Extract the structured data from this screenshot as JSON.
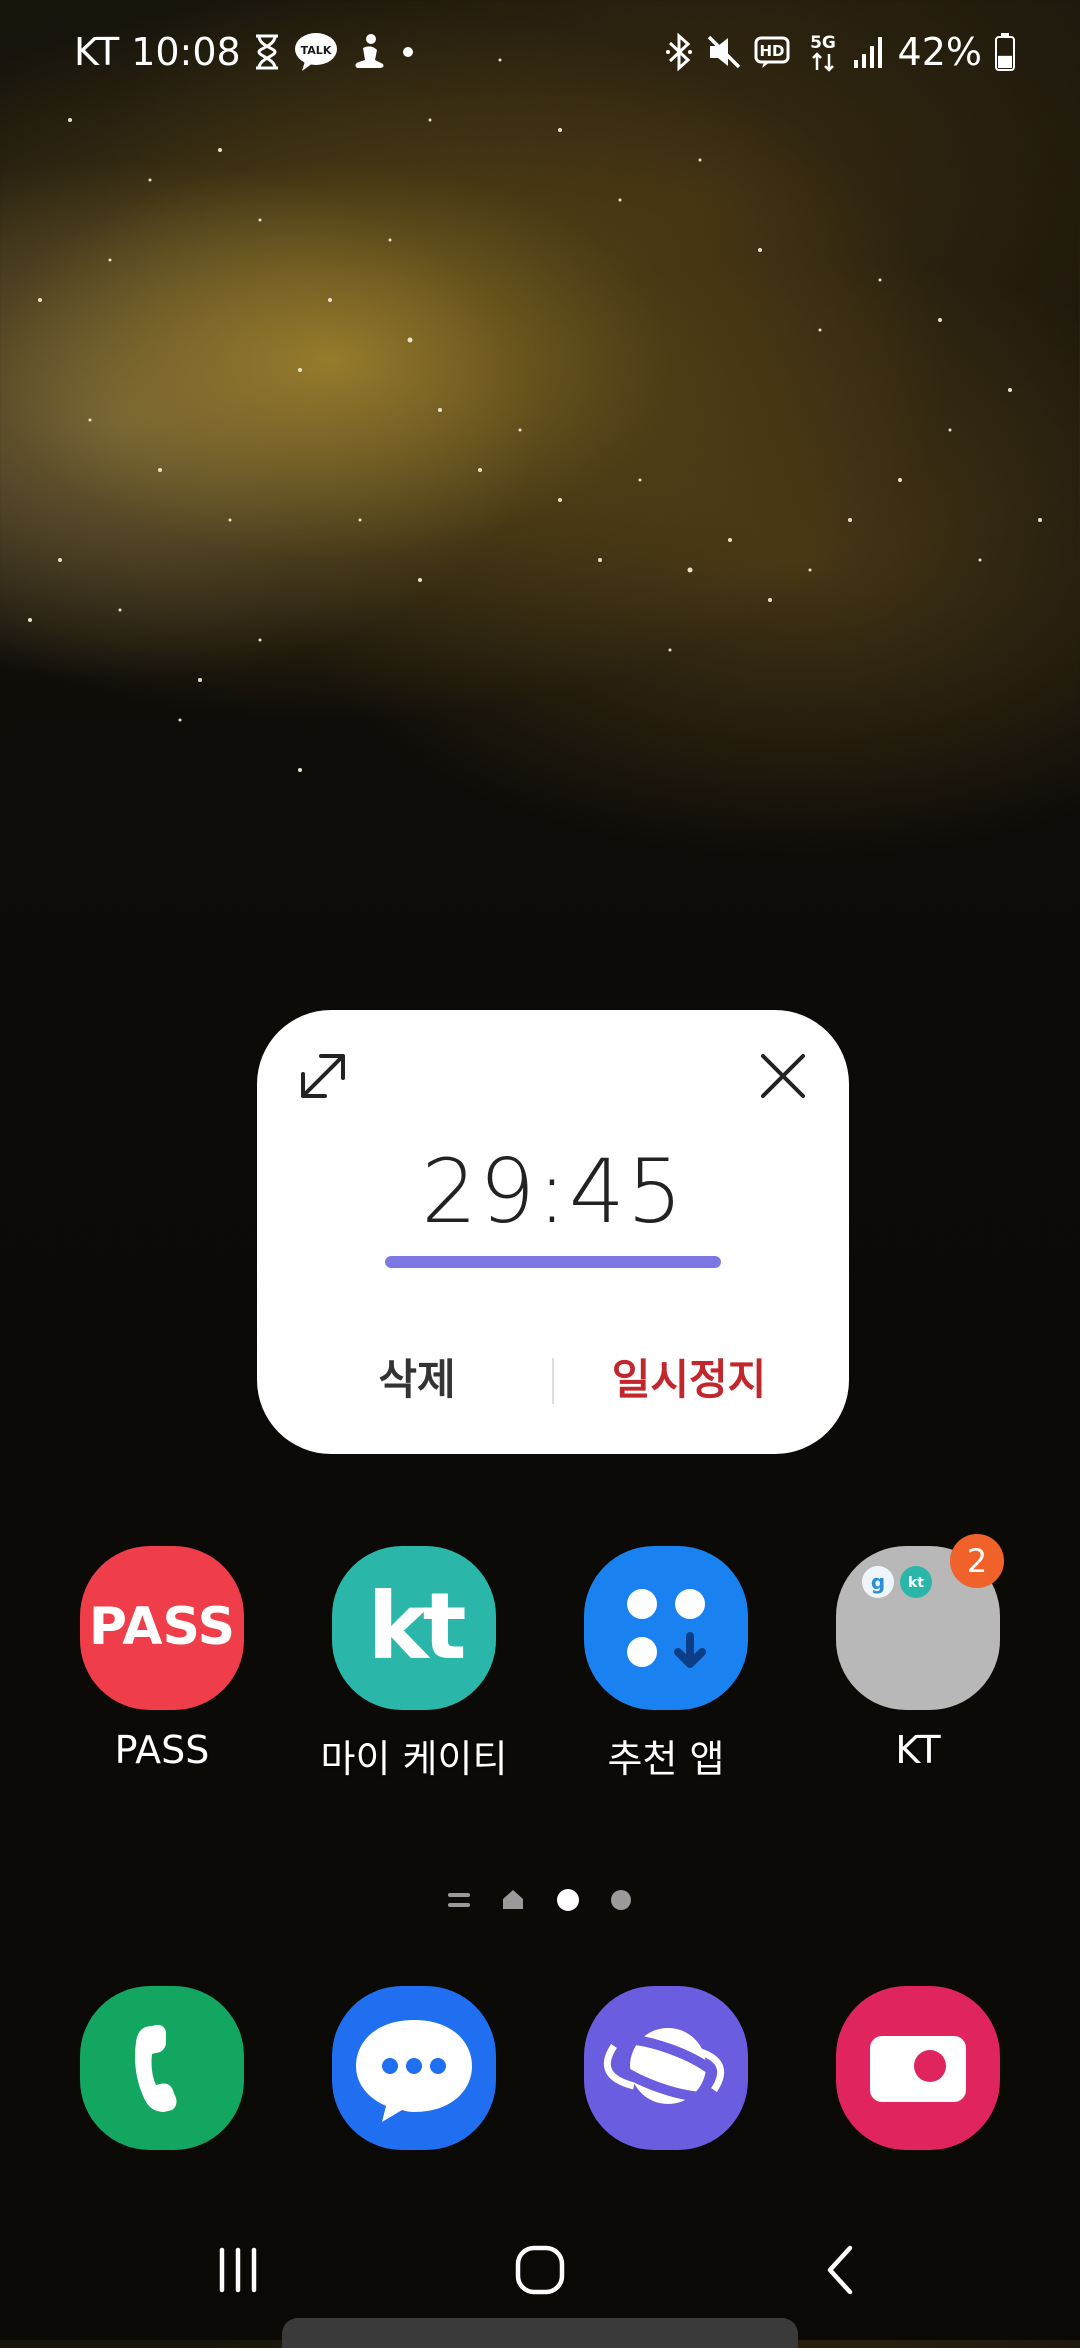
{
  "status_bar": {
    "carrier": "KT",
    "time": "10:08",
    "battery": "42%",
    "battery_level": 0.42,
    "left_icons": [
      "hourglass-icon",
      "kakaotalk-icon",
      "meditation-icon",
      "dot-icon"
    ],
    "right_icons": [
      "bluetooth-icon",
      "mute-icon",
      "hd-voice-icon",
      "5g-icon",
      "signal-icon",
      "battery-icon"
    ],
    "kakao_label": "TALK",
    "hd_label": "HD",
    "fiveg_label": "5G"
  },
  "timer_widget": {
    "time": "29:45",
    "progress": 1.0,
    "delete_label": "삭제",
    "pause_label": "일시정지",
    "progress_color": "#7b78e4",
    "pause_color": "#c1272d"
  },
  "apps": [
    {
      "label": "PASS",
      "icon_text": "PASS",
      "color": "#ef3e4a"
    },
    {
      "label": "마이 케이티",
      "icon_text": "kt",
      "color": "#2ab7a9"
    },
    {
      "label": "추천 앱",
      "icon_text": "",
      "color": "#1a82f0"
    },
    {
      "label": "KT",
      "icon_text": "",
      "color": "#b8b8b8",
      "badge": "2",
      "folder_app_1": "g",
      "folder_app_2": "kt"
    }
  ],
  "dock": [
    {
      "name": "phone-icon",
      "color": "#13a660"
    },
    {
      "name": "messages-icon",
      "color": "#1f6ff0"
    },
    {
      "name": "internet-icon",
      "color": "#6b5de0"
    },
    {
      "name": "camera-icon",
      "color": "#e0245e"
    }
  ],
  "pager": {
    "pages": [
      "menu",
      "home",
      "active",
      "dot"
    ],
    "active_index": 2
  },
  "nav": {
    "recent": "recent-apps-icon",
    "home": "home-icon",
    "back": "back-icon"
  }
}
